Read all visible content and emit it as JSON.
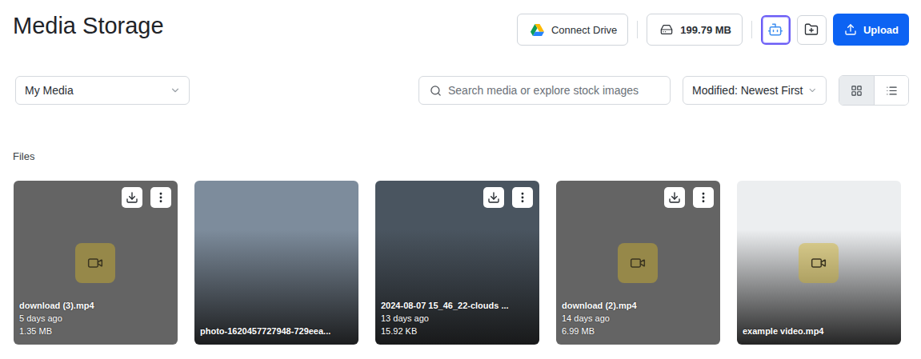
{
  "title": "Media Storage",
  "toolbar": {
    "connect": "Connect Drive",
    "storage": "199.79 MB",
    "upload": "Upload",
    "assistant_active": true
  },
  "folder_select": {
    "value": "My Media"
  },
  "search": {
    "placeholder": "Search media or explore stock images"
  },
  "sort": {
    "value": "Modified: Newest First"
  },
  "view_modes": [
    {
      "kind": "grid",
      "selected": true
    },
    {
      "kind": "list",
      "selected": false
    }
  ],
  "section": "Files",
  "files": [
    {
      "name": "download (3).mp4",
      "age": "5 days ago",
      "size": "1.35 MB",
      "kind": "video",
      "actions": true,
      "thumbnail": false,
      "color": "#646464"
    },
    {
      "name": "photo-1620457727948-729eea...",
      "age": "",
      "size": "",
      "kind": "photo",
      "actions": false,
      "thumbnail": true,
      "color": "#7d8c9c"
    },
    {
      "name": "2024-08-07 15_46_22-clouds ...",
      "age": "13 days ago",
      "size": "15.92 KB",
      "kind": "photo",
      "actions": true,
      "thumbnail": true,
      "color": "#4a5560"
    },
    {
      "name": "download (2).mp4",
      "age": "14 days ago",
      "size": "6.99 MB",
      "kind": "video",
      "actions": true,
      "thumbnail": false,
      "color": "#646464"
    },
    {
      "name": "example video.mp4",
      "age": "",
      "size": "",
      "kind": "video",
      "actions": false,
      "thumbnail": true,
      "color": "#eceef0"
    }
  ]
}
